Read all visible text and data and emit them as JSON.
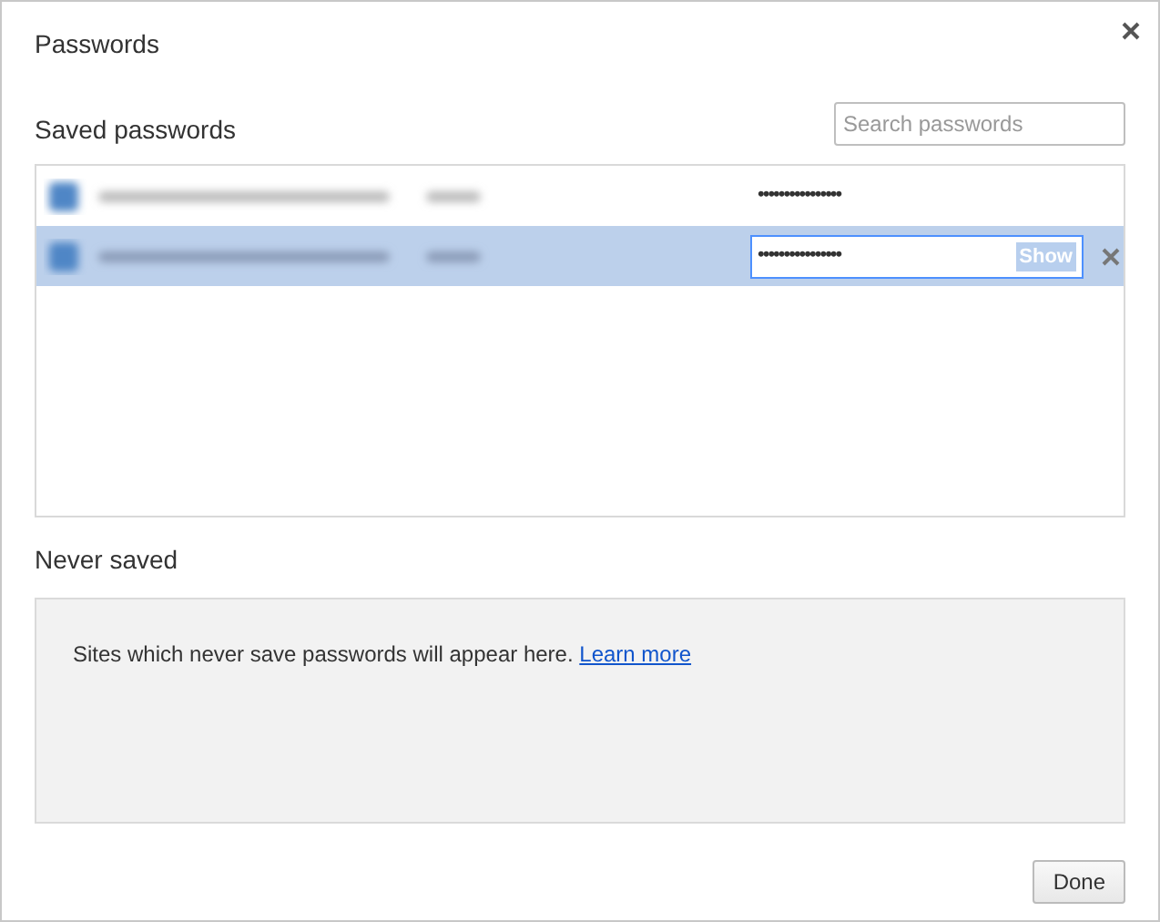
{
  "dialog": {
    "title": "Passwords"
  },
  "saved_passwords": {
    "heading": "Saved passwords",
    "search": {
      "placeholder": "Search passwords"
    },
    "rows": [
      {
        "password": "••••••••••••••••",
        "selected": false
      },
      {
        "password": "••••••••••••••••",
        "selected": true,
        "show_button": "Show"
      }
    ]
  },
  "never_saved": {
    "heading": "Never saved",
    "message": "Sites which never save passwords will appear here.",
    "link": "Learn more"
  },
  "buttons": {
    "done": "Done"
  }
}
